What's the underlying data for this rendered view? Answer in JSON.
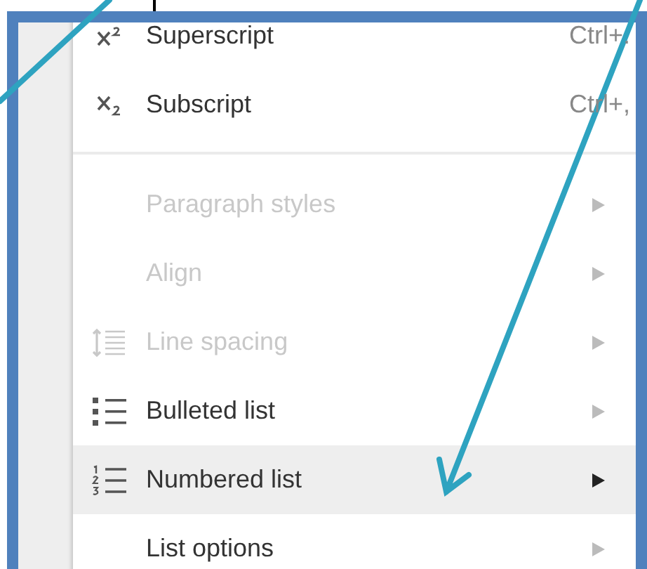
{
  "menu": {
    "items": [
      {
        "kind": "item",
        "label": "Superscript",
        "shortcut": "Ctrl+.",
        "disabled": false,
        "selected": false,
        "submenu": false
      },
      {
        "kind": "item",
        "label": "Subscript",
        "shortcut": "Ctrl+,",
        "disabled": false,
        "selected": false,
        "submenu": false
      },
      {
        "kind": "separator"
      },
      {
        "kind": "item",
        "label": "Paragraph styles",
        "disabled": true,
        "selected": false,
        "submenu": true
      },
      {
        "kind": "item",
        "label": "Align",
        "disabled": true,
        "selected": false,
        "submenu": true
      },
      {
        "kind": "item",
        "label": "Line spacing",
        "disabled": true,
        "selected": false,
        "submenu": true
      },
      {
        "kind": "item",
        "label": "Bulleted list",
        "disabled": false,
        "selected": false,
        "submenu": true
      },
      {
        "kind": "item",
        "label": "Numbered list",
        "disabled": false,
        "selected": true,
        "submenu": true
      },
      {
        "kind": "item",
        "label": "List options",
        "disabled": false,
        "selected": false,
        "submenu": true
      }
    ]
  }
}
